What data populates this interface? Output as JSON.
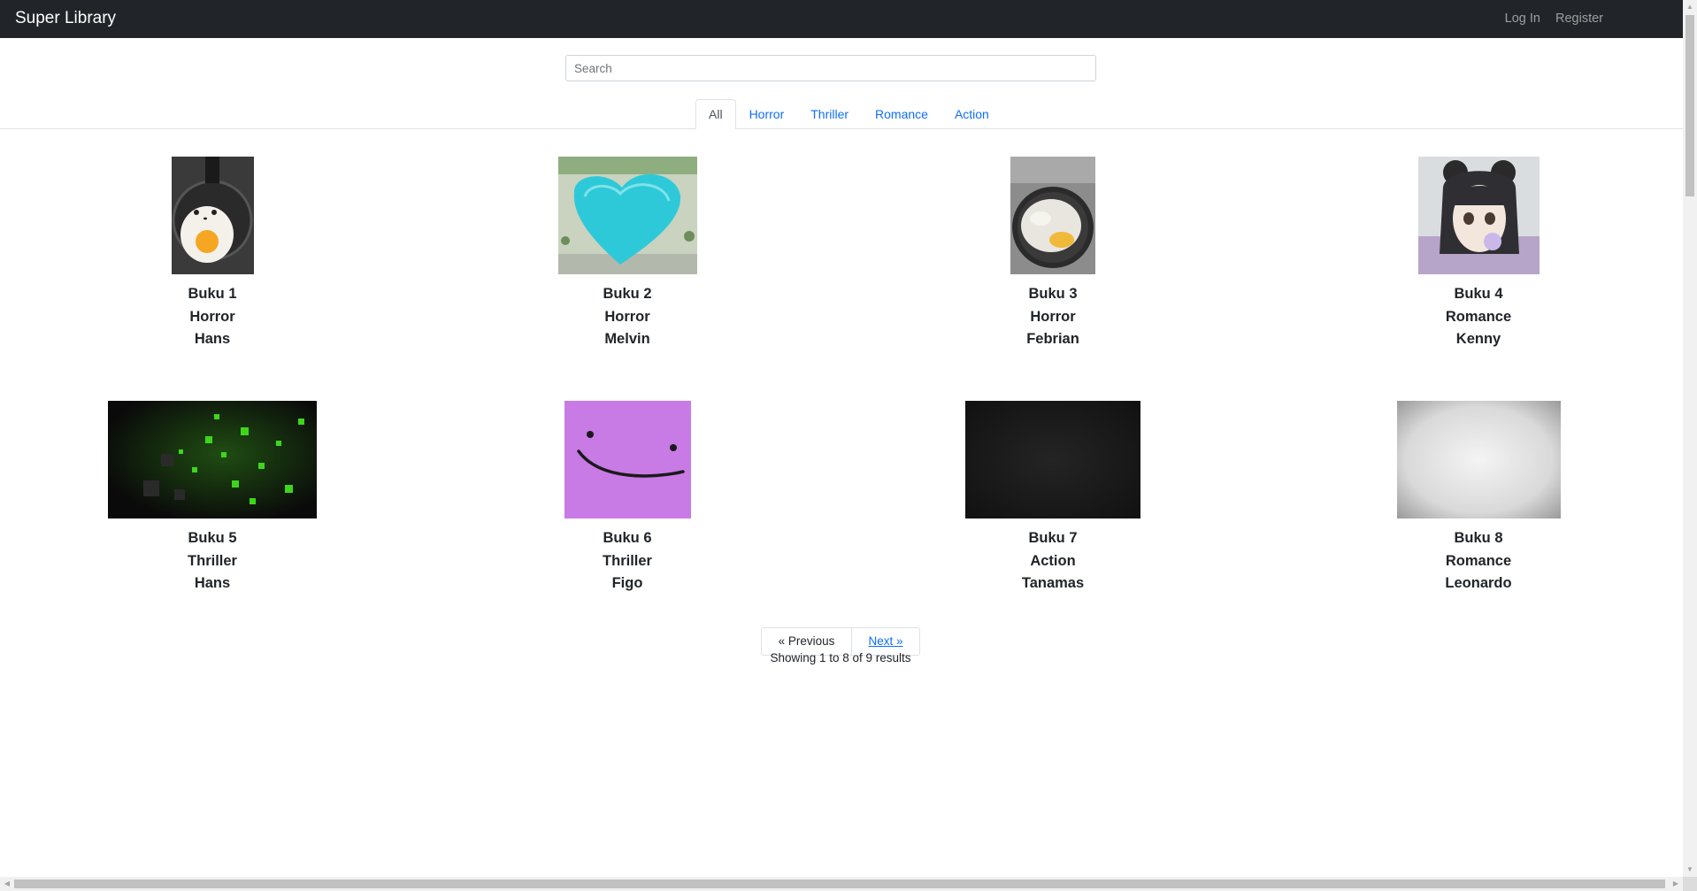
{
  "navbar": {
    "brand": "Super Library",
    "login": "Log In",
    "register": "Register"
  },
  "search": {
    "placeholder": "Search",
    "value": ""
  },
  "tabs": [
    {
      "label": "All",
      "active": true
    },
    {
      "label": "Horror",
      "active": false
    },
    {
      "label": "Thriller",
      "active": false
    },
    {
      "label": "Romance",
      "active": false
    },
    {
      "label": "Action",
      "active": false
    }
  ],
  "books": [
    {
      "title": "Buku 1",
      "genre": "Horror",
      "author": "Hans"
    },
    {
      "title": "Buku 2",
      "genre": "Horror",
      "author": "Melvin"
    },
    {
      "title": "Buku 3",
      "genre": "Horror",
      "author": "Febrian"
    },
    {
      "title": "Buku 4",
      "genre": "Romance",
      "author": "Kenny"
    },
    {
      "title": "Buku 5",
      "genre": "Thriller",
      "author": "Hans"
    },
    {
      "title": "Buku 6",
      "genre": "Thriller",
      "author": "Figo"
    },
    {
      "title": "Buku 7",
      "genre": "Action",
      "author": "Tanamas"
    },
    {
      "title": "Buku 8",
      "genre": "Romance",
      "author": "Leonardo"
    }
  ],
  "pagination": {
    "previous": "« Previous",
    "next": "Next »",
    "results": "Showing 1 to 8 of 9 results"
  }
}
